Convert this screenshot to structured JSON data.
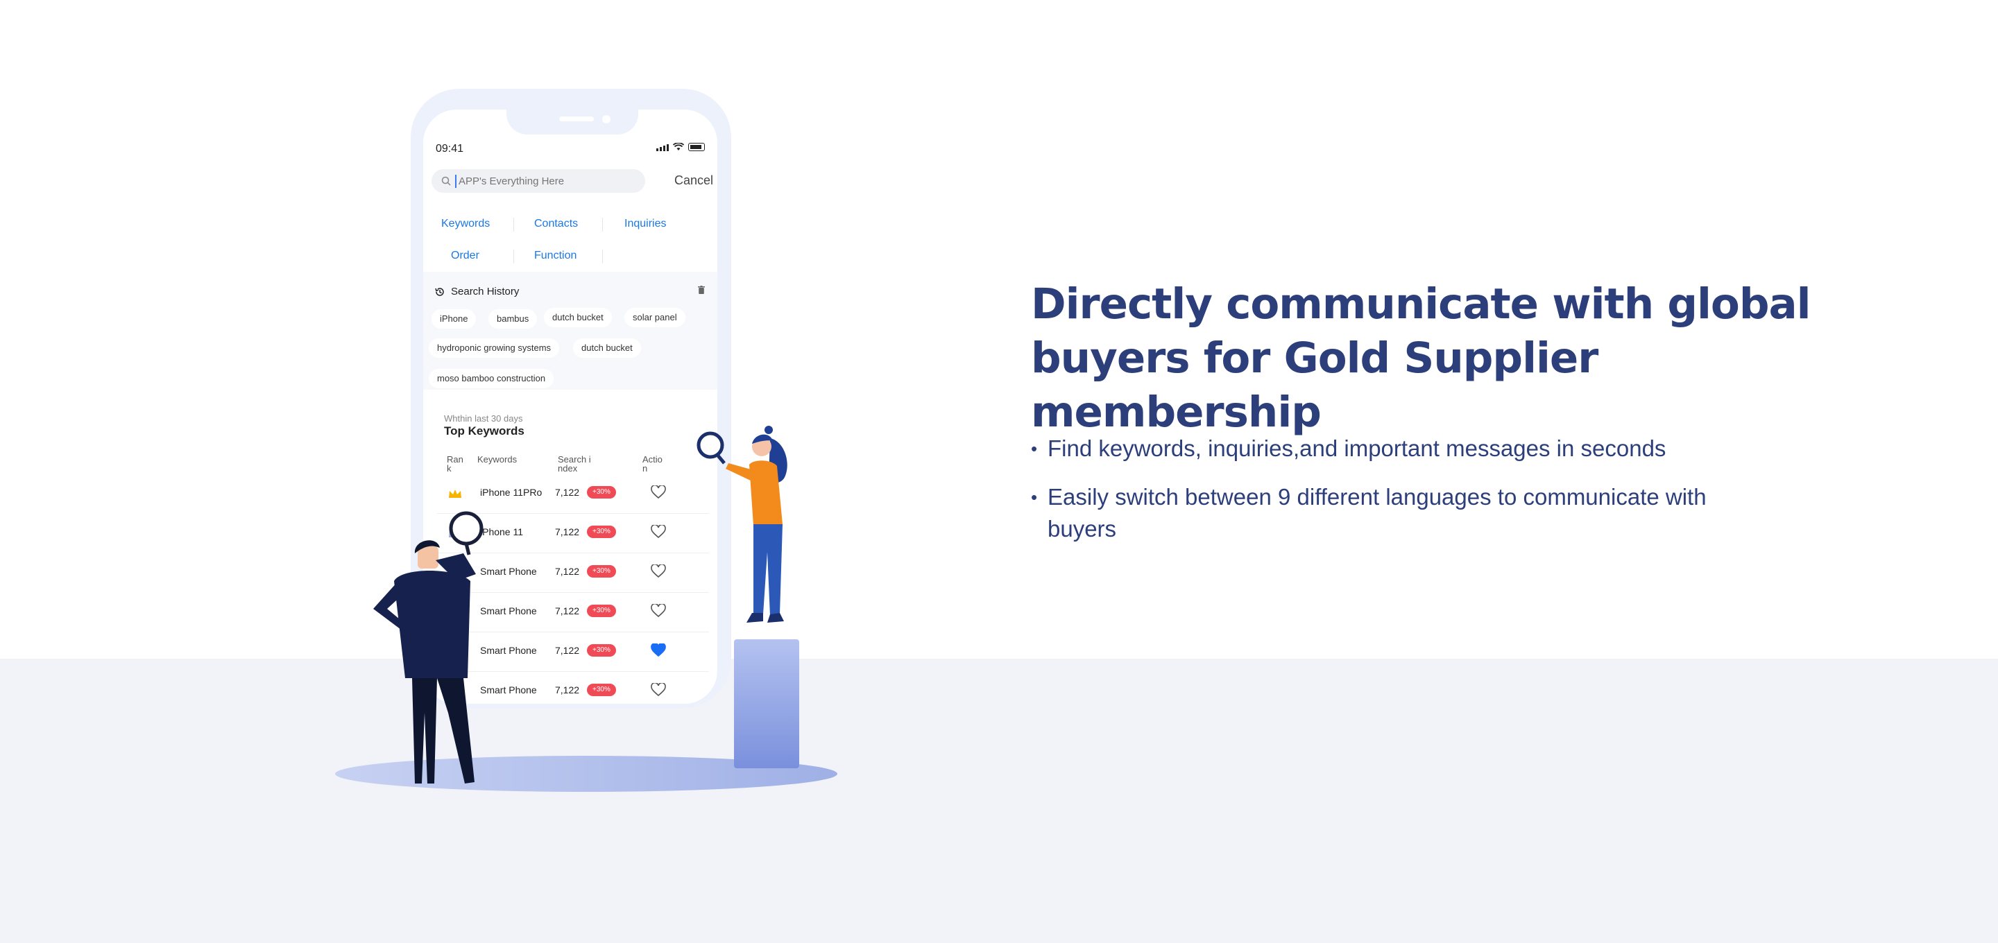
{
  "colors": {
    "heading": "#2c3f7b",
    "accent": "#1a78e6",
    "badge": "#f04a56",
    "bottom_band": "#f1f3f9"
  },
  "phone": {
    "status_time": "09:41",
    "search": {
      "placeholder": "APP's Everything Here",
      "cancel_label": "Cancel"
    },
    "categories": [
      "Keywords",
      "Contacts",
      "Inquiries",
      "Order",
      "Function"
    ],
    "history": {
      "title": "Search History",
      "tags": [
        "iPhone",
        "bambus",
        "dutch bucket",
        "solar panel",
        "hydroponic growing systems",
        "dutch bucket",
        "moso bamboo construction"
      ]
    },
    "keywords_card": {
      "subtitle": "Whthin last 30 days",
      "title": "Top Keywords",
      "columns": [
        "Rank",
        "Keywords",
        "Search index",
        "Action"
      ],
      "rows": [
        {
          "name": "iPhone 11PRo",
          "value": "7,122",
          "change": "+30%",
          "rank_icon": "gold-crown-icon",
          "favorited": false
        },
        {
          "name": "iPhone 11",
          "value": "7,122",
          "change": "+30%",
          "rank_icon": "silver-crown-icon",
          "favorited": false
        },
        {
          "name": "Smart Phone",
          "value": "7,122",
          "change": "+30%",
          "rank_icon": "",
          "favorited": false
        },
        {
          "name": "Smart Phone",
          "value": "7,122",
          "change": "+30%",
          "rank_icon": "",
          "favorited": false
        },
        {
          "name": "Smart Phone",
          "value": "7,122",
          "change": "+30%",
          "rank_icon": "",
          "favorited": true
        },
        {
          "name": "Smart Phone",
          "value": "7,122",
          "change": "+30%",
          "rank_icon": "",
          "favorited": false
        }
      ]
    }
  },
  "hero": {
    "headline_line1": "Directly communicate with global",
    "headline_line2": "buyers for Gold Supplier membership",
    "bullets": [
      "Find keywords, inquiries,and important messages in seconds",
      "Easily switch between 9 different languages to communicate with buyers"
    ]
  }
}
